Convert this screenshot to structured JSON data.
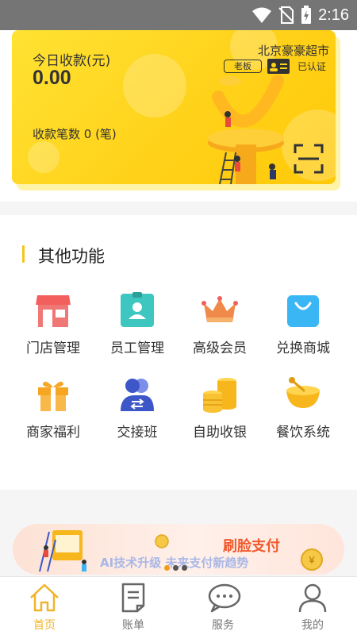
{
  "status_bar": {
    "time": "2:16"
  },
  "card": {
    "today_label": "今日收款(元)",
    "today_amount": "0.00",
    "count_label": "收款笔数 0 (笔)",
    "store_name": "北京豪豪超市",
    "role_badge": "老板",
    "verified_label": "已认证"
  },
  "functions": {
    "title": "其他功能",
    "items": [
      {
        "label": "门店管理",
        "icon": "store-icon"
      },
      {
        "label": "员工管理",
        "icon": "employee-badge-icon"
      },
      {
        "label": "高级会员",
        "icon": "crown-icon"
      },
      {
        "label": "兑换商城",
        "icon": "shopping-bag-icon"
      },
      {
        "label": "商家福利",
        "icon": "gift-icon"
      },
      {
        "label": "交接班",
        "icon": "shift-handover-icon"
      },
      {
        "label": "自助收银",
        "icon": "coins-icon"
      },
      {
        "label": "餐饮系统",
        "icon": "food-bowl-icon"
      }
    ]
  },
  "banner": {
    "title": "刷脸支付",
    "subtitle": "AI技术升级 未来支付新趋势"
  },
  "bottom_nav": {
    "items": [
      {
        "label": "首页",
        "icon": "home-icon"
      },
      {
        "label": "账单",
        "icon": "bill-icon"
      },
      {
        "label": "服务",
        "icon": "service-chat-icon"
      },
      {
        "label": "我的",
        "icon": "profile-icon"
      }
    ],
    "active": 0
  },
  "colors": {
    "accent": "#f0b429",
    "card": "#ffd21a",
    "banner_title": "#f05a2e"
  }
}
